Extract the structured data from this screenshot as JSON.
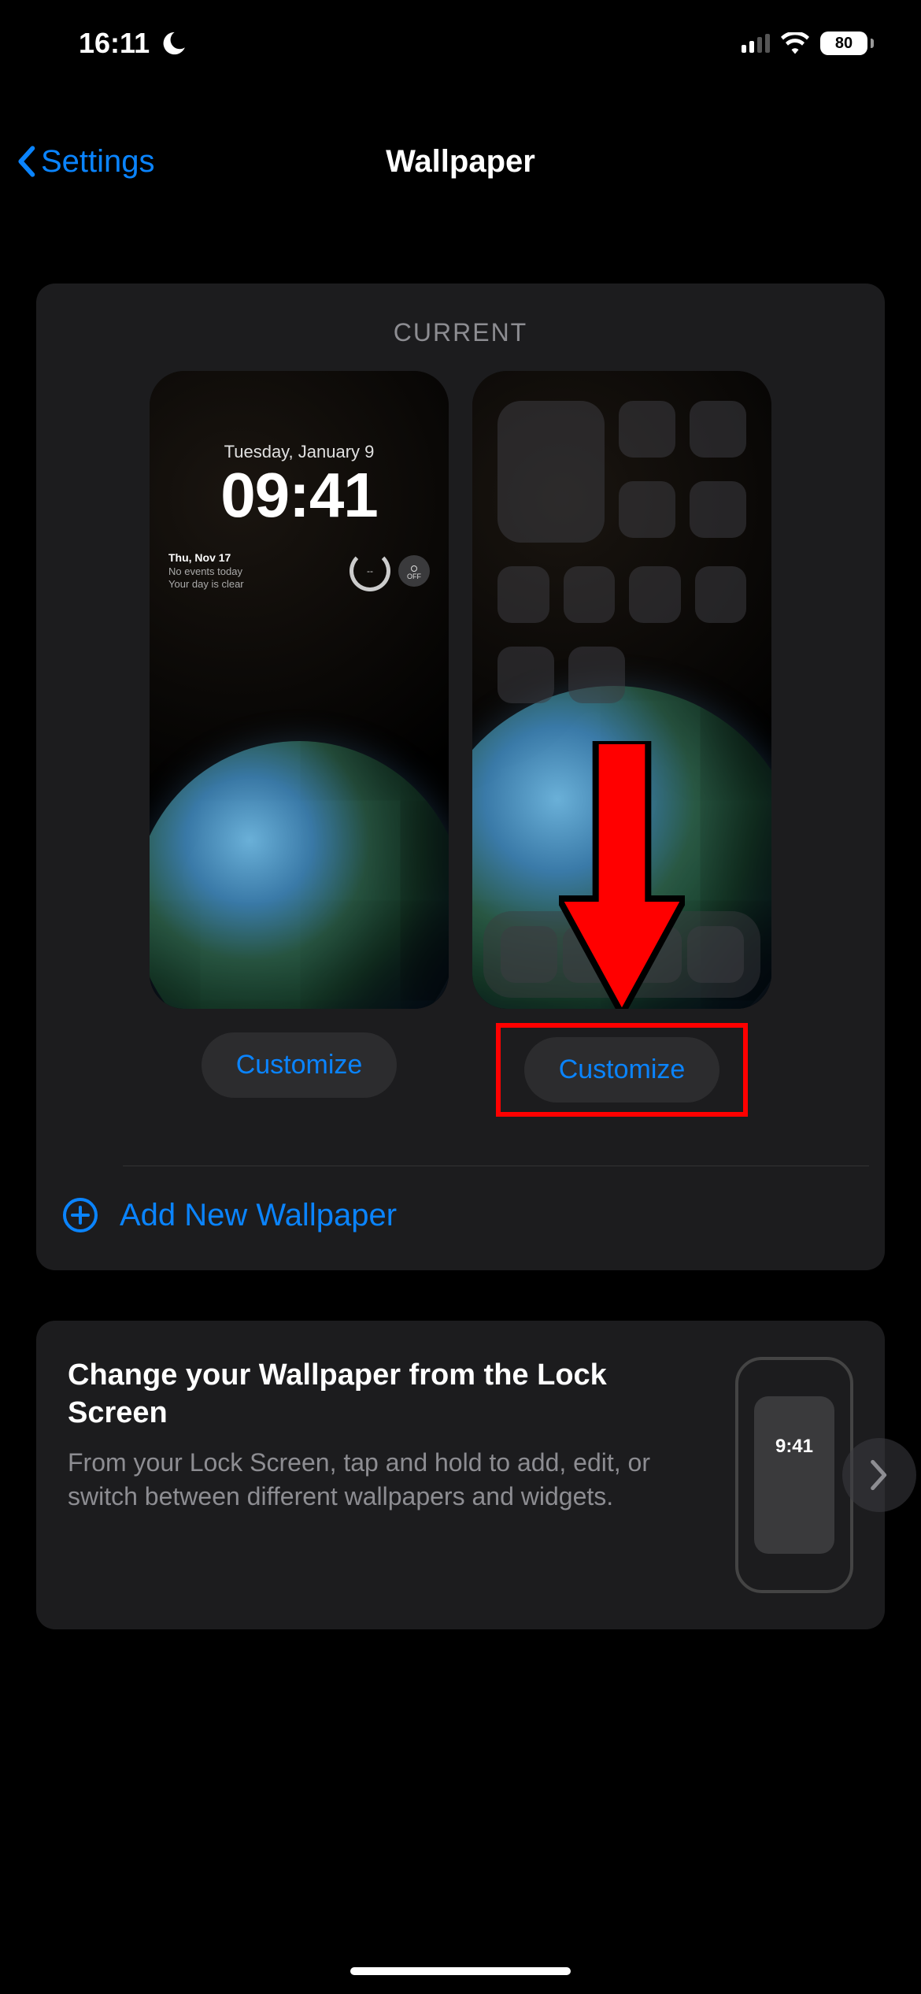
{
  "status": {
    "time": "16:11",
    "battery": "80"
  },
  "nav": {
    "back": "Settings",
    "title": "Wallpaper"
  },
  "current": {
    "label": "CURRENT",
    "lockscreen": {
      "date": "Tuesday, January 9",
      "time": "09:41",
      "widget_line1": "Thu, Nov 17",
      "widget_line2": "No events today",
      "widget_line3": "Your day is clear",
      "ring_text": "--",
      "toggle_text": "OFF"
    },
    "customize_lock": "Customize",
    "customize_home": "Customize"
  },
  "add_new": "Add New Wallpaper",
  "info": {
    "title": "Change your Wallpaper from the Lock Screen",
    "body": "From your Lock Screen, tap and hold to add, edit, or switch between different wallpapers and widgets.",
    "mini_time": "9:41"
  }
}
